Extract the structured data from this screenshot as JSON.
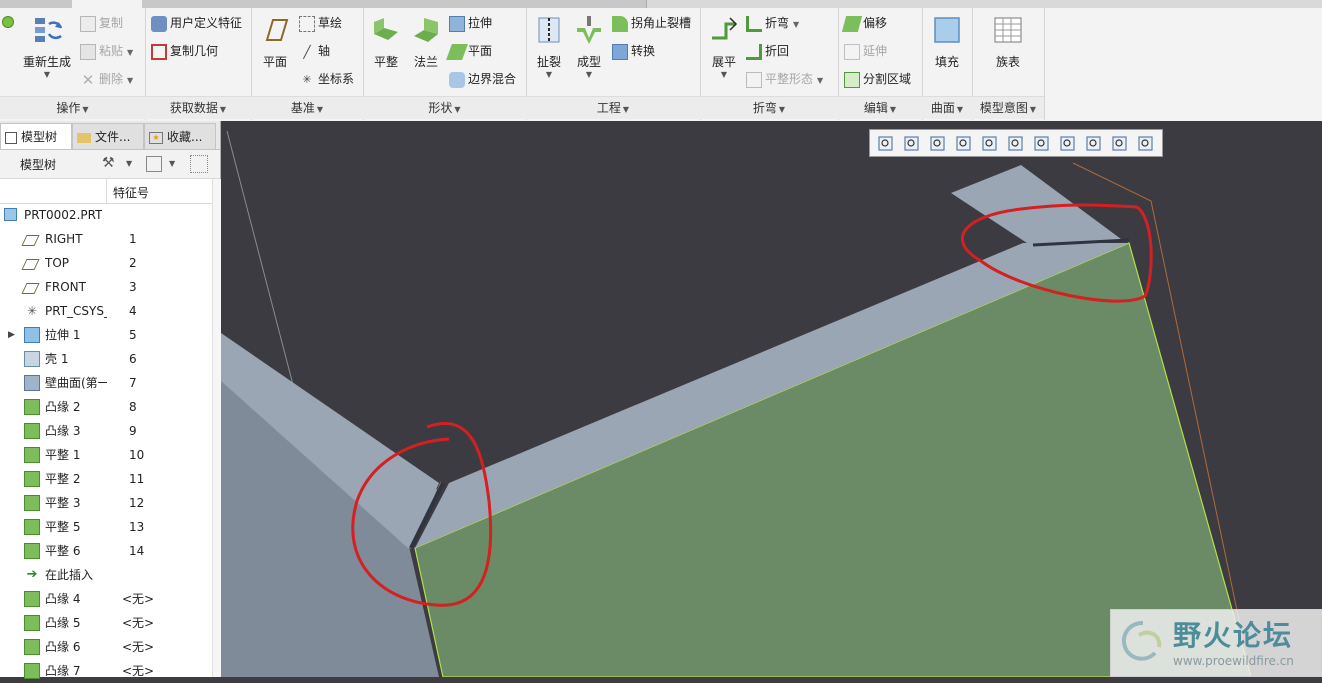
{
  "ribbon": {
    "groups": {
      "operations": {
        "label": "操作",
        "regenerate": "重新生成",
        "copy": "复制",
        "paste": "粘贴",
        "delete": "删除"
      },
      "get_data": {
        "label": "获取数据",
        "udf": "用户定义特征",
        "copy_geometry": "复制几何"
      },
      "datum": {
        "label": "基准",
        "plane": "平面",
        "sketch": "草绘",
        "axis": "轴",
        "csys": "坐标系"
      },
      "shapes": {
        "label": "形状",
        "planar": "平整",
        "flange": "法兰",
        "extrude": "拉伸",
        "flat": "平面",
        "boundary_blend": "边界混合"
      },
      "engineering": {
        "label": "工程",
        "rip": "扯裂",
        "form": "成型",
        "corner_relief": "拐角止裂槽",
        "convert": "转换"
      },
      "bends": {
        "label": "折弯",
        "unbend": "展平",
        "bend": "折弯",
        "bend_back": "折回",
        "flat_state": "平整形态"
      },
      "editing": {
        "label": "编辑",
        "offset": "偏移",
        "extend": "延伸",
        "split_area": "分割区域"
      },
      "surfaces": {
        "label": "曲面",
        "fill": "填充"
      },
      "model_intent": {
        "label": "模型意图",
        "family_table": "族表"
      }
    }
  },
  "left_panel": {
    "tabs": [
      {
        "label": "模型树"
      },
      {
        "label": "文件..."
      },
      {
        "label": "收藏..."
      }
    ],
    "tree_title": "模型树",
    "column_header": "特征号",
    "root": "PRT0002.PRT",
    "rows": [
      {
        "label": "RIGHT",
        "num": "1",
        "icon": "datum-plane-icon"
      },
      {
        "label": "TOP",
        "num": "2",
        "icon": "datum-plane-icon"
      },
      {
        "label": "FRONT",
        "num": "3",
        "icon": "datum-plane-icon"
      },
      {
        "label": "PRT_CSYS_",
        "num": "4",
        "icon": "csys-icon"
      },
      {
        "label": "拉伸 1",
        "num": "5",
        "icon": "extrude-icon"
      },
      {
        "label": "壳 1",
        "num": "6",
        "icon": "shell-icon"
      },
      {
        "label": "壁曲面(第一",
        "num": "7",
        "icon": "wall-surface-icon"
      },
      {
        "label": "凸缘 2",
        "num": "8",
        "icon": "flange-icon"
      },
      {
        "label": "凸缘 3",
        "num": "9",
        "icon": "flange-icon"
      },
      {
        "label": "平整 1",
        "num": "10",
        "icon": "planar-wall-icon"
      },
      {
        "label": "平整 2",
        "num": "11",
        "icon": "planar-wall-icon"
      },
      {
        "label": "平整 3",
        "num": "12",
        "icon": "planar-wall-icon"
      },
      {
        "label": "平整 5",
        "num": "13",
        "icon": "planar-wall-icon"
      },
      {
        "label": "平整 6",
        "num": "14",
        "icon": "planar-wall-icon"
      },
      {
        "label": "在此插入",
        "num": "",
        "icon": "insert-arrow-icon"
      },
      {
        "label": "凸缘 4",
        "num": "<无>",
        "icon": "flange-icon"
      },
      {
        "label": "凸缘 5",
        "num": "<无>",
        "icon": "flange-icon"
      },
      {
        "label": "凸缘 6",
        "num": "<无>",
        "icon": "flange-icon"
      },
      {
        "label": "凸缘 7",
        "num": "<无>",
        "icon": "flange-icon"
      }
    ]
  },
  "viewport": {
    "background": "#3b3b41",
    "wall_color": "#9aa6b4",
    "face_color": "#6b8a66",
    "annotation_color": "#d42020",
    "toolbar_icons": [
      "refit-icon",
      "zoom-in-icon",
      "zoom-out-icon",
      "repaint-icon",
      "display-style-icon",
      "saved-views-icon",
      "view-manager-icon",
      "datum-display-icon",
      "spin-center-icon",
      "annotation-display-icon",
      "appearance-icon"
    ]
  },
  "watermark": {
    "title": "野火论坛",
    "url": "www.proewildfire.cn"
  }
}
